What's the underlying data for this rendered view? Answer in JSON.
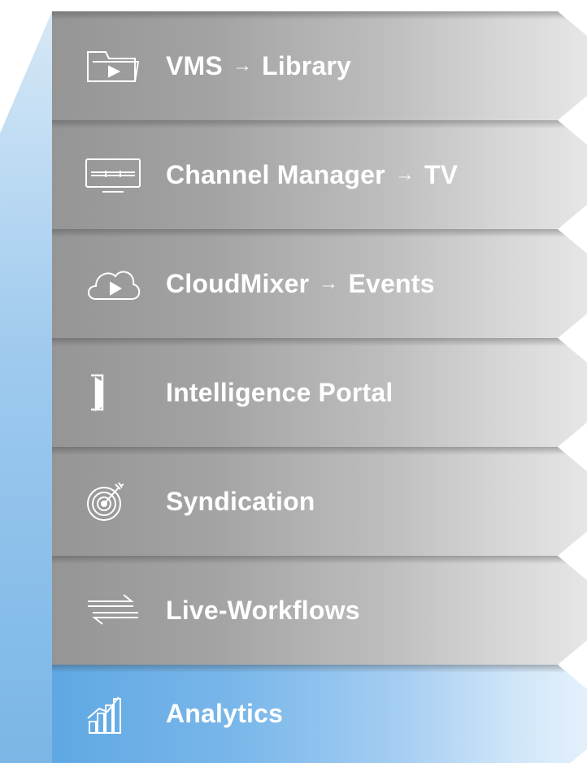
{
  "stack": {
    "items": [
      {
        "name": "VMS",
        "target": "Library",
        "arrow": "→",
        "icon": "folder-play-icon",
        "color": "gray"
      },
      {
        "name": "Channel Manager",
        "target": "TV",
        "arrow": "→",
        "icon": "tv-icon",
        "color": "gray"
      },
      {
        "name": "CloudMixer",
        "target": "Events",
        "arrow": "→",
        "icon": "cloud-play-icon",
        "color": "gray"
      },
      {
        "name": "Intelligence Portal",
        "target": "",
        "arrow": "",
        "icon": "portal-door-icon",
        "color": "gray"
      },
      {
        "name": "Syndication",
        "target": "",
        "arrow": "",
        "icon": "target-icon",
        "color": "gray"
      },
      {
        "name": "Live-Workflows",
        "target": "",
        "arrow": "",
        "icon": "exchange-arrows-icon",
        "color": "gray"
      },
      {
        "name": "Analytics",
        "target": "",
        "arrow": "",
        "icon": "bar-chart-icon",
        "color": "blue"
      }
    ]
  },
  "colors": {
    "gray_band": "#a3a3a3",
    "blue_band": "#7ab7ea",
    "text": "#ffffff"
  }
}
